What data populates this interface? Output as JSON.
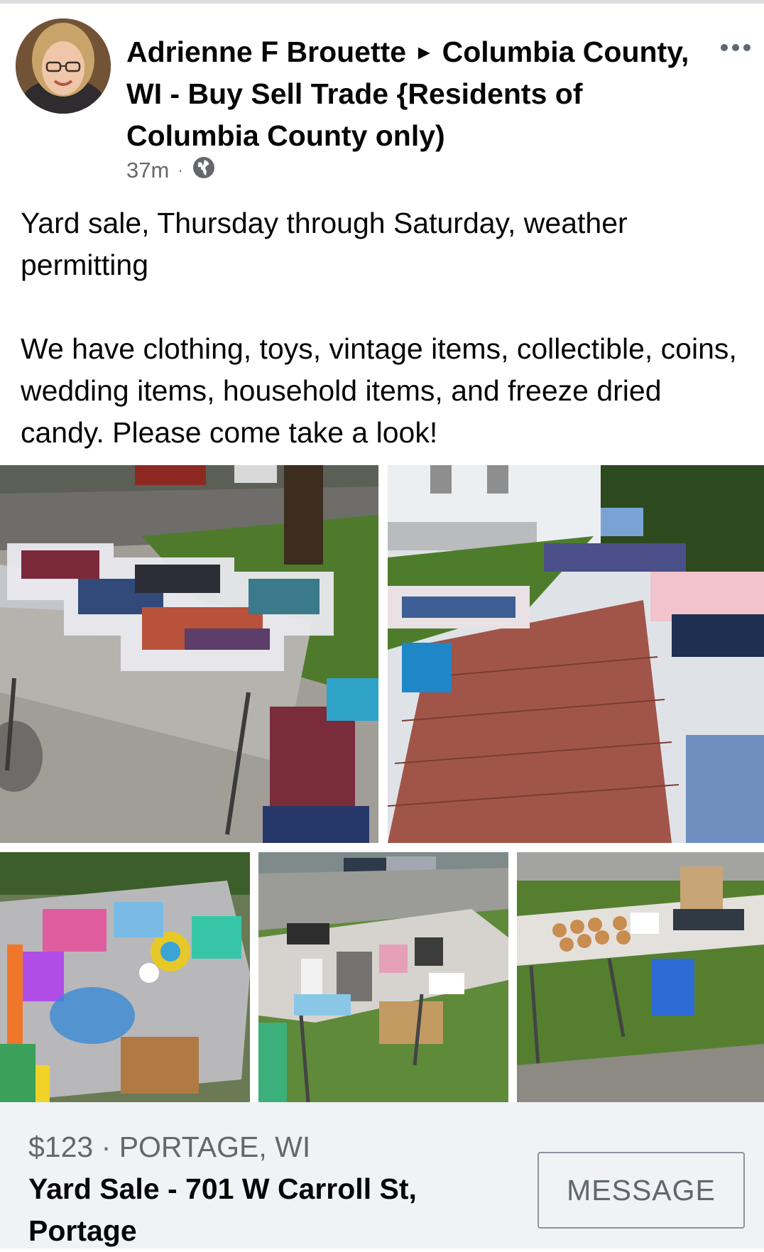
{
  "post": {
    "author": "Adrienne F Brouette",
    "group_arrow": "►",
    "group": "Columbia County, WI - Buy Sell Trade {Residents of Columbia County only)",
    "time": "37m",
    "separator": "·",
    "audience_icon": "globe-icon",
    "text": "Yard sale, Thursday through Saturday, weather permitting\n\nWe have clothing, toys, vintage items, collectible, coins, wedding items, household items, and freeze dried candy. Please come take a look!"
  },
  "header": {
    "more_icon": "more-horizontal-icon"
  },
  "listing": {
    "price": "$123",
    "dot": "·",
    "location": "PORTAGE, WI",
    "title": "Yard Sale - 701 W Carroll St, Portage",
    "message_label": "MESSAGE"
  },
  "colors": {
    "text_primary": "#050505",
    "text_secondary": "#65676b",
    "listing_bg": "#f0f2f5",
    "button_border": "#8d949e"
  }
}
